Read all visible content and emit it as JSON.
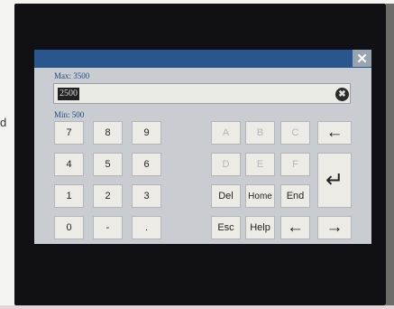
{
  "side_text": "d",
  "dialog": {
    "close_glyph": "✕",
    "max_label": "Max: 3500",
    "min_label": "Min: 500",
    "value": "2500",
    "clear_glyph": "✖"
  },
  "keypad": {
    "digits": [
      "7",
      "8",
      "9",
      "4",
      "5",
      "6",
      "1",
      "2",
      "3",
      "0",
      "-",
      "."
    ],
    "hex": [
      "A",
      "B",
      "C",
      "D",
      "E",
      "F"
    ],
    "backspace": "←",
    "enter": "↵",
    "del": "Del",
    "home": "Home",
    "end": "End",
    "esc": "Esc",
    "help": "Help",
    "left": "←",
    "right": "→"
  },
  "colors": {
    "titlebar": "#2a568e",
    "label_text": "#1f4a86",
    "key_face": "#ecebe6"
  }
}
